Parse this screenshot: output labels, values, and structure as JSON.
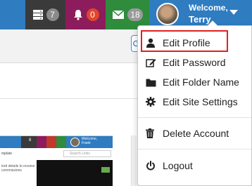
{
  "topbar": {
    "servers_count": "7",
    "alerts_count": "0",
    "messages_count": "18",
    "welcome": "Welcome,",
    "user_name": "Terry"
  },
  "dropdown": {
    "items": [
      {
        "label": "Edit Profile",
        "icon": "user-icon"
      },
      {
        "label": "Edit Password",
        "icon": "edit-icon"
      },
      {
        "label": "Edit Folder Name",
        "icon": "folder-icon"
      },
      {
        "label": "Edit Site Settings",
        "icon": "gear-icon"
      },
      {
        "label": "Delete Account",
        "icon": "trash-icon"
      },
      {
        "label": "Logout",
        "icon": "power-icon"
      }
    ],
    "highlighted": "Edit Profile"
  },
  "thumbnail": {
    "servers_count": "8",
    "welcome": "Welcome,",
    "user_name": "Frank",
    "search_placeholder": "Search Links",
    "template_text": "mplate",
    "copy_text": "ired details to receive commissions"
  },
  "colors": {
    "topbar": "#2f7cc0",
    "servers_bg": "#3a3a3a",
    "alerts_bg": "#8c1c5b",
    "messages_bg": "#2e8c3c",
    "highlight_border": "#e02020"
  }
}
